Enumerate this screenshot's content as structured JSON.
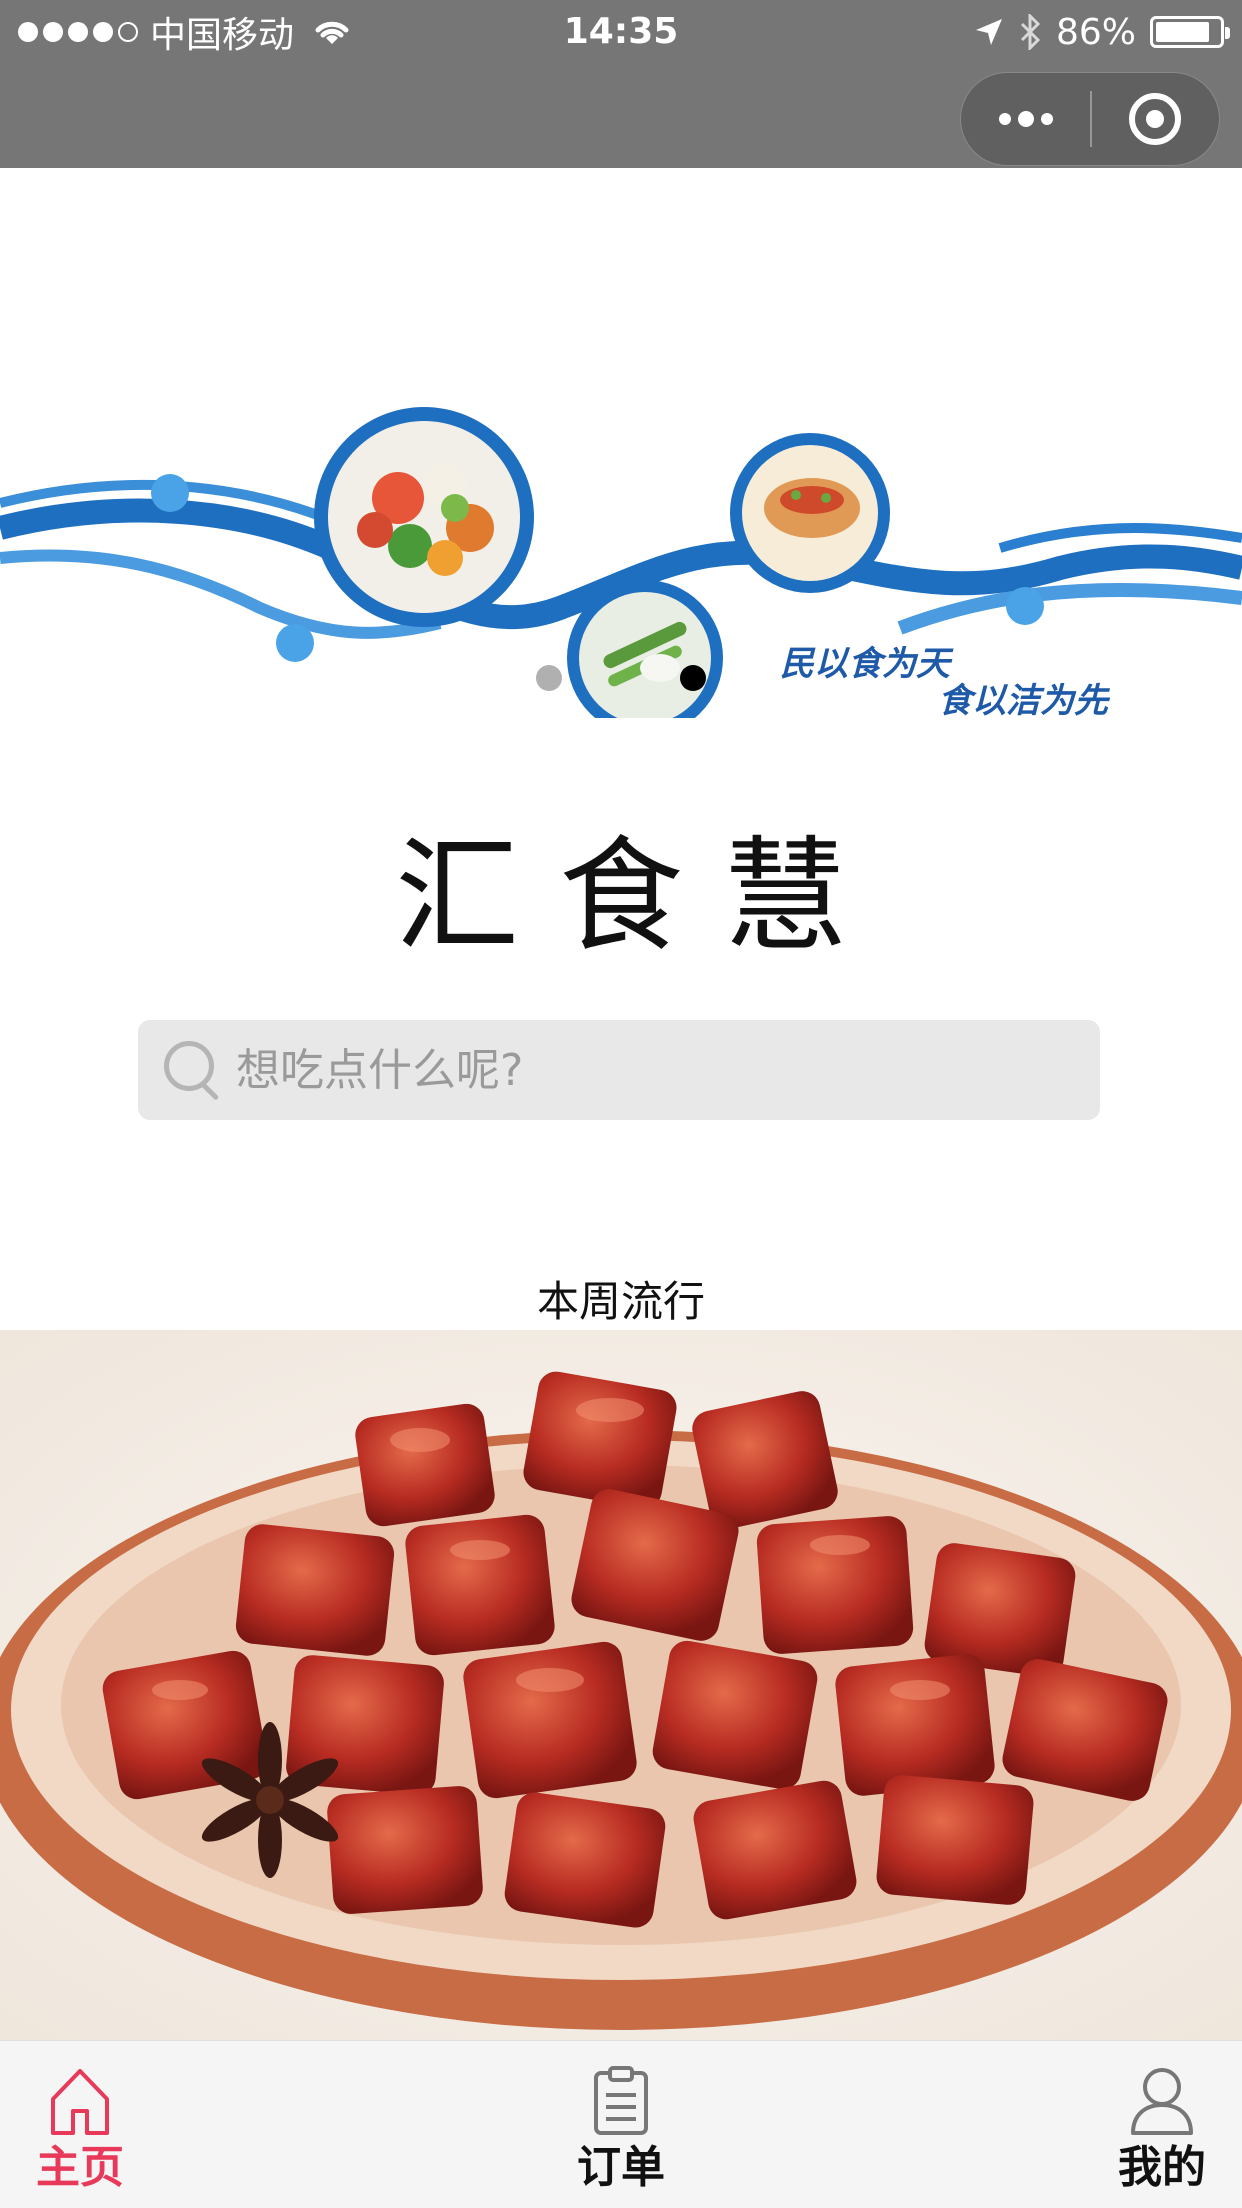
{
  "status_bar": {
    "carrier": "中国移动",
    "time": "14:35",
    "battery": "86%",
    "battery_level": 0.86,
    "signal_bars_filled": 4,
    "signal_bars_total": 5
  },
  "capsule": {
    "more_icon": "more-dots-icon",
    "close_icon": "target-circle-icon"
  },
  "banner": {
    "slogan_line1": "民以食为天",
    "slogan_line2": "食以洁为先",
    "slide_count": 2,
    "active_slide": 2
  },
  "app_title": "汇食慧",
  "search": {
    "placeholder": "想吃点什么呢?",
    "value": ""
  },
  "section_title": "本周流行",
  "tabbar": {
    "items": [
      {
        "label": "主页",
        "icon": "home-icon",
        "active": true
      },
      {
        "label": "订单",
        "icon": "clipboard-icon",
        "active": false
      },
      {
        "label": "我的",
        "icon": "person-icon",
        "active": false
      }
    ]
  },
  "colors": {
    "nav_bar": "#767676",
    "active_tab": "#e8395a",
    "banner_wave": "#1e6fc0",
    "search_bg": "#e8e8e8"
  }
}
